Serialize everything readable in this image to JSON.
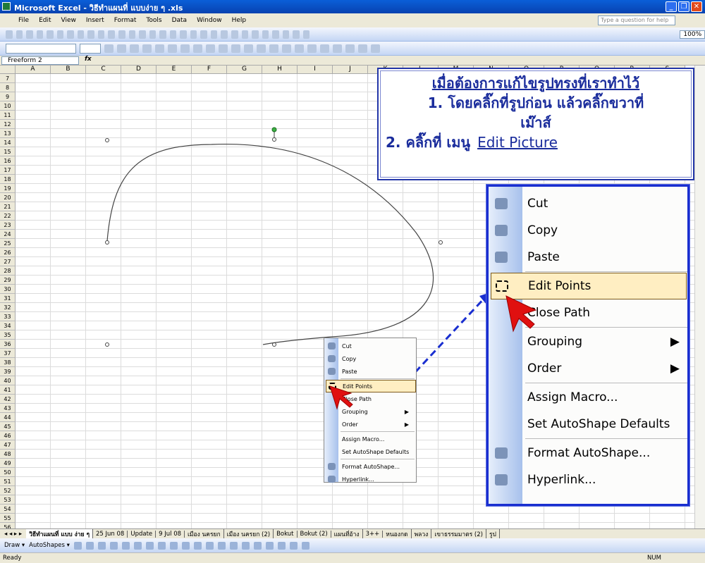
{
  "window": {
    "title": "Microsoft Excel - วิธีทำแผนที่ แบบง่าย ๆ .xls",
    "min": "_",
    "max": "❐",
    "close": "✕"
  },
  "menu": {
    "items": [
      "File",
      "Edit",
      "View",
      "Insert",
      "Format",
      "Tools",
      "Data",
      "Window",
      "Help"
    ],
    "help_placeholder": "Type a question for help"
  },
  "toolbar": {
    "zoom": "100%"
  },
  "formula": {
    "name_box": "Freeform 2",
    "fx": "fx"
  },
  "columns": [
    "A",
    "B",
    "C",
    "D",
    "E",
    "F",
    "G",
    "H",
    "I",
    "J",
    "K",
    "L",
    "M",
    "N",
    "O",
    "P",
    "Q",
    "R",
    "S"
  ],
  "rows": [
    7,
    8,
    9,
    10,
    11,
    12,
    13,
    14,
    15,
    16,
    17,
    18,
    19,
    20,
    21,
    22,
    23,
    24,
    25,
    26,
    27,
    28,
    29,
    30,
    31,
    32,
    33,
    34,
    35,
    36,
    37,
    38,
    39,
    40,
    41,
    42,
    43,
    44,
    45,
    46,
    47,
    48,
    49,
    50,
    51,
    52,
    53,
    54,
    55,
    56
  ],
  "callout": {
    "heading": "เมื่อต้องการแก้ไขรูปทรงที่เราทำไว้",
    "step1": "1. โดยคลิ๊กที่รูปก่อน แล้วคลิ๊กขวาที่",
    "step1b": "เม๊าส์",
    "step2": "2. คลิ๊กที่ เมนู",
    "step2_link": "Edit Picture"
  },
  "context_menu": {
    "items": [
      {
        "label": "Cut",
        "icon": "scissors-icon"
      },
      {
        "label": "Copy",
        "icon": "copy-icon"
      },
      {
        "label": "Paste",
        "icon": "paste-icon"
      },
      {
        "label": "Edit Points",
        "icon": "edit-points-icon",
        "highlighted": true
      },
      {
        "label": "Close Path"
      },
      {
        "label": "Grouping",
        "submenu": true
      },
      {
        "label": "Order",
        "submenu": true
      },
      {
        "label": "Assign Macro..."
      },
      {
        "label": "Set AutoShape Defaults"
      },
      {
        "label": "Format AutoShape...",
        "icon": "format-icon"
      },
      {
        "label": "Hyperlink...",
        "icon": "hyperlink-icon"
      }
    ]
  },
  "sheet_tabs": [
    "วิธีทำแผนที่ แบบ ง่าย ๆ",
    "25 Jun 08",
    "Update",
    "9 Jul 08",
    "เมือง นครยก",
    "เมือง นครยก (2)",
    "Bokut",
    "Bokut (2)",
    "แผนที่อ้าง",
    "3++",
    "หนองกด",
    "พลวง",
    "เขาธรรมมาตร (2)",
    "รูป"
  ],
  "draw_toolbar": {
    "draw": "Draw ▾",
    "autoshapes": "AutoShapes ▾"
  },
  "status": {
    "left": "Ready",
    "num": "NUM"
  },
  "colors": {
    "accent": "#1a2fd0",
    "title_bar": "#0a5fd8",
    "highlight": "#ffeec2",
    "arrow": "#e01010"
  }
}
